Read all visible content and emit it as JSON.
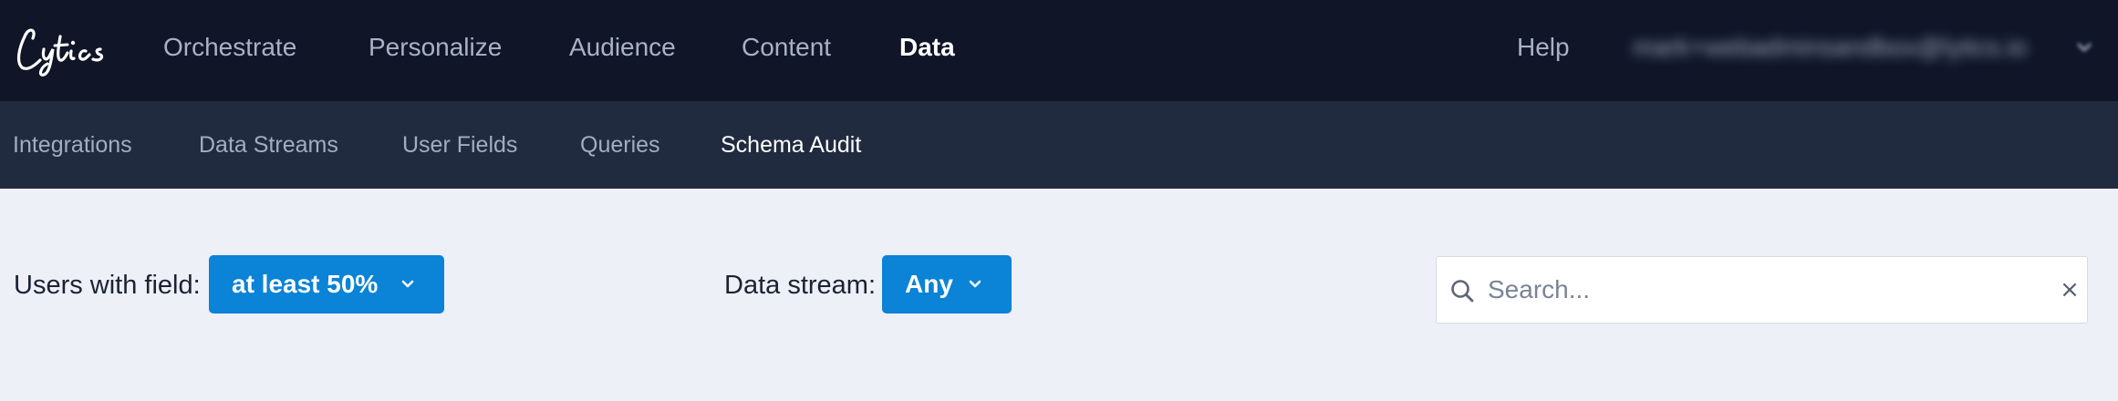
{
  "brand": {
    "logo_text": "Lytics"
  },
  "top_nav": {
    "items": [
      {
        "label": "Orchestrate",
        "active": false
      },
      {
        "label": "Personalize",
        "active": false
      },
      {
        "label": "Audience",
        "active": false
      },
      {
        "label": "Content",
        "active": false
      },
      {
        "label": "Data",
        "active": true
      }
    ],
    "help_label": "Help",
    "user_email": "mark+webadminsandbox@lytics.io"
  },
  "sub_nav": {
    "items": [
      {
        "label": "Integrations",
        "active": false
      },
      {
        "label": "Data Streams",
        "active": false
      },
      {
        "label": "User Fields",
        "active": false
      },
      {
        "label": "Queries",
        "active": false
      },
      {
        "label": "Schema Audit",
        "active": true
      }
    ]
  },
  "filters": {
    "users_with_field": {
      "label": "Users with field:",
      "value": "at least 50%"
    },
    "data_stream": {
      "label": "Data stream:",
      "value": "Any"
    }
  },
  "search": {
    "placeholder": "Search...",
    "value": "",
    "clear_glyph": "×"
  },
  "icons": {
    "search": "search-icon",
    "clear": "close-icon",
    "chevron": "chevron-down-icon"
  },
  "colors": {
    "topbar_bg": "#101628",
    "subbar_bg": "#212b40",
    "page_bg": "#edf0f7",
    "accent": "#0b83d6"
  }
}
